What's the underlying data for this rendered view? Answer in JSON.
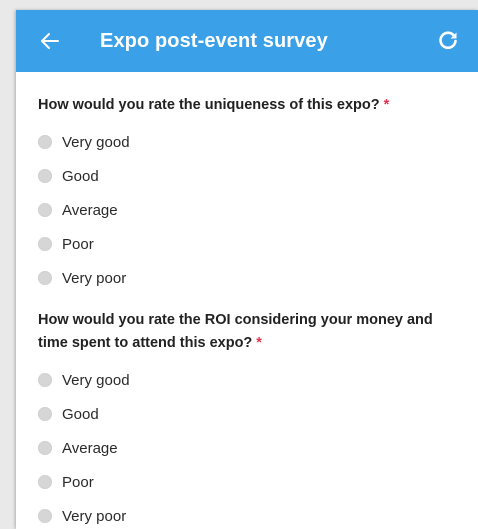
{
  "appbar": {
    "title": "Expo post-event survey",
    "back_icon": "arrow-left-icon",
    "refresh_icon": "refresh-icon",
    "color": "#3aa0e8"
  },
  "required_mark": "*",
  "questions": [
    {
      "text": "How would you rate the uniqueness of this expo?",
      "options": [
        "Very good",
        "Good",
        "Average",
        "Poor",
        "Very poor"
      ]
    },
    {
      "text": "How would you rate the ROI considering your money and time spent to attend this expo?",
      "options": [
        "Very good",
        "Good",
        "Average",
        "Poor",
        "Very poor"
      ]
    }
  ]
}
